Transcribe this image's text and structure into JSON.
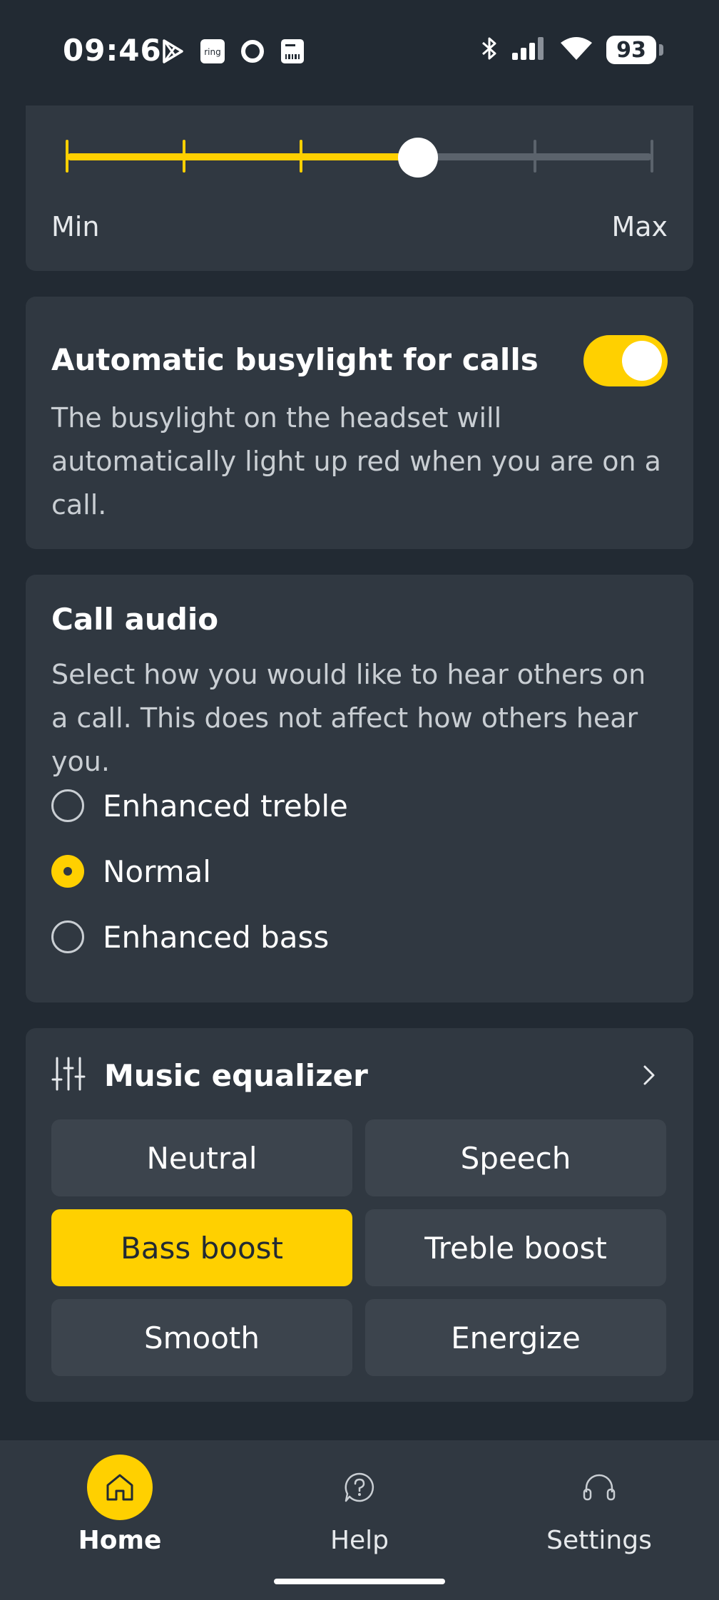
{
  "status_bar": {
    "time": "09:46",
    "battery": "93",
    "notification_icons": [
      "play-store-icon",
      "ring-icon",
      "circle-icon",
      "barcode-icon"
    ],
    "system_icons": [
      "bluetooth-icon",
      "signal-icon",
      "wifi-icon",
      "battery-icon"
    ]
  },
  "volume_slider": {
    "min_label": "Min",
    "max_label": "Max",
    "level_fraction": 0.6,
    "steps": 6
  },
  "busylight": {
    "title": "Automatic busylight for calls",
    "description": "The busylight on the headset will automatically light up red when you are on a call.",
    "enabled": true
  },
  "call_audio": {
    "title": "Call audio",
    "description": "Select how you would like to hear others on a call. This does not affect how others hear you.",
    "options": [
      {
        "label": "Enhanced treble",
        "selected": false
      },
      {
        "label": "Normal",
        "selected": true
      },
      {
        "label": "Enhanced bass",
        "selected": false
      }
    ]
  },
  "equalizer": {
    "title": "Music equalizer",
    "presets": [
      {
        "label": "Neutral",
        "active": false
      },
      {
        "label": "Speech",
        "active": false
      },
      {
        "label": "Bass boost",
        "active": true
      },
      {
        "label": "Treble boost",
        "active": false
      },
      {
        "label": "Smooth",
        "active": false
      },
      {
        "label": "Energize",
        "active": false
      }
    ]
  },
  "nav": {
    "items": [
      {
        "label": "Home",
        "icon": "home-icon",
        "active": true
      },
      {
        "label": "Help",
        "icon": "help-icon",
        "active": false
      },
      {
        "label": "Settings",
        "icon": "headset-icon",
        "active": false
      }
    ]
  },
  "colors": {
    "background": "#222a33",
    "card": "#303841",
    "accent": "#ffd000"
  }
}
